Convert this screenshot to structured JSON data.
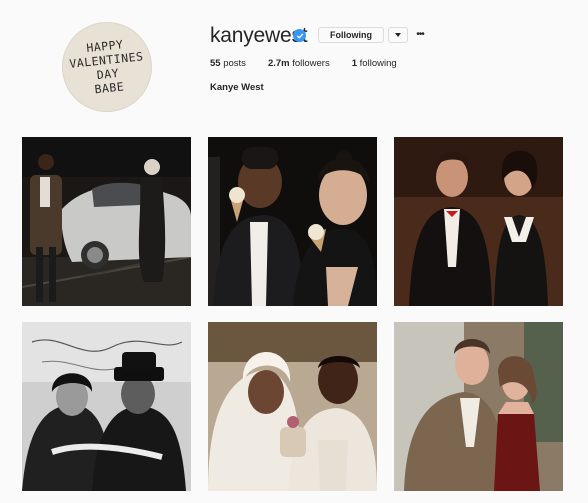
{
  "profile": {
    "avatar_text": "HAPPY\nVALENTINES\nDAY\nBABE",
    "username": "kanyewest",
    "verified": true,
    "follow_button_label": "Following",
    "full_name": "Kanye West",
    "stats": {
      "posts_count": "55",
      "posts_label": "posts",
      "followers_count": "2.7m",
      "followers_label": "followers",
      "following_count": "1",
      "following_label": "following"
    }
  },
  "colors": {
    "verified_badge": "#3897f0",
    "background": "#fafafa",
    "border": "#dbdbdb"
  },
  "posts": [
    {
      "id": "post-1",
      "description": "couple beside white car at night"
    },
    {
      "id": "post-2",
      "description": "couple eating ice cream cones"
    },
    {
      "id": "post-3",
      "description": "couple in tuxedo and black white dress"
    },
    {
      "id": "post-4",
      "description": "black and white couple photo"
    },
    {
      "id": "post-5",
      "description": "wedding couple with bride in veil"
    },
    {
      "id": "post-6",
      "description": "couple in suit and red dress"
    }
  ]
}
